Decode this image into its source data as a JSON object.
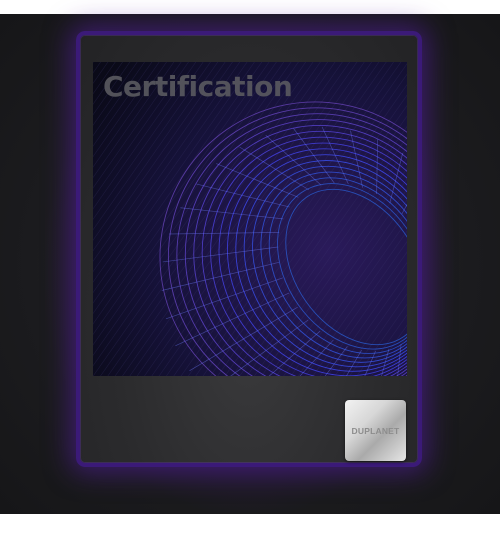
{
  "card": {
    "title": "Certification",
    "badge_text": "DUPLANET"
  },
  "colors": {
    "background": "#1c1c1f",
    "card_border": "#3b1a78",
    "glow": "#5a14aa",
    "art_background": "#0d0b1e",
    "wireframe": "#4a6cff",
    "title": "#5a5a60"
  },
  "icons": {
    "artwork": "wireframe-torus-icon",
    "badge": "duplanet-logo-icon"
  }
}
